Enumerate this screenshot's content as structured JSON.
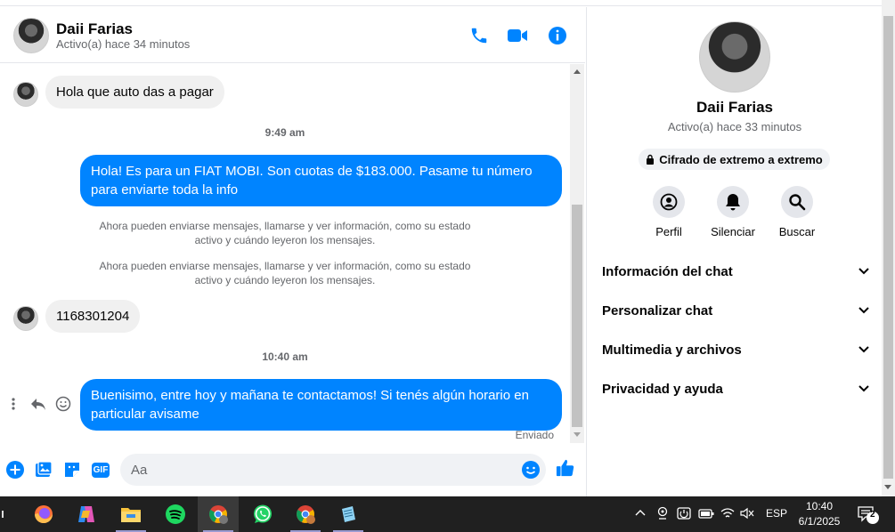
{
  "header": {
    "name": "Daii Farias",
    "status": "Activo(a) hace 34 minutos"
  },
  "messages": {
    "m1": "Hola que auto das a pagar",
    "t1": "9:49 am",
    "m2": "Hola! Es para un FIAT MOBI. Son cuotas de $183.000. Pasame tu número para enviarte toda la info",
    "sys1": "Ahora pueden enviarse mensajes, llamarse y ver información, como su estado activo y cuándo leyeron los mensajes.",
    "sys2": "Ahora pueden enviarse mensajes, llamarse y ver información, como su estado activo y cuándo leyeron los mensajes.",
    "m3": "1168301204",
    "t2": "10:40 am",
    "m4": "Buenisimo, entre hoy y mañana te contactamos! Si tenés algún horario en particular avisame",
    "sent_status": "Enviado"
  },
  "composer": {
    "placeholder": "Aa",
    "gif_label": "GIF"
  },
  "panel": {
    "name": "Daii Farias",
    "status": "Activo(a) hace 33 minutos",
    "encryption": "Cifrado de extremo a extremo",
    "actions": [
      "Perfil",
      "Silenciar",
      "Buscar"
    ],
    "sections": [
      "Información del chat",
      "Personalizar chat",
      "Multimedia y archivos",
      "Privacidad y ayuda"
    ]
  },
  "taskbar": {
    "lang": "ESP",
    "time": "10:40",
    "date": "6/1/2025",
    "notif_count": "2"
  },
  "colors": {
    "accent": "#0084ff",
    "bubble_in": "#f0f0f0"
  }
}
